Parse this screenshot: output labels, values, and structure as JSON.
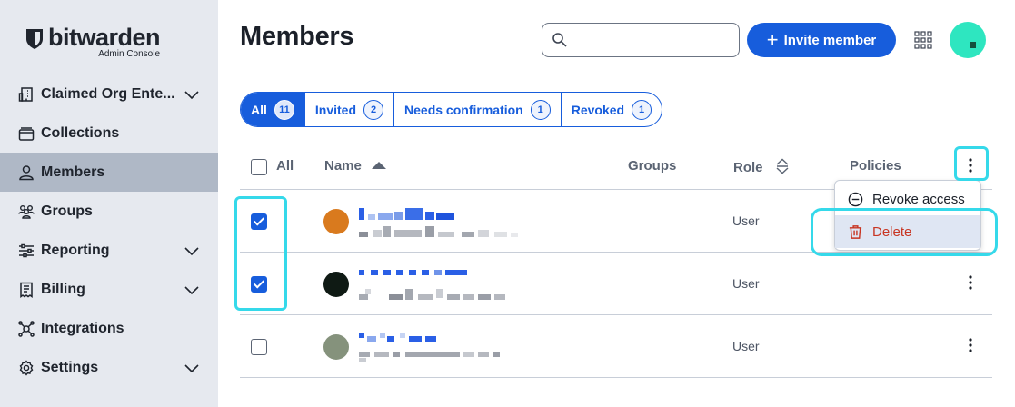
{
  "brand": {
    "name": "bitwarden",
    "subtitle": "Admin Console"
  },
  "sidebar": {
    "items": [
      {
        "label": "Claimed Org Ente...",
        "icon": "building-icon",
        "has_chevron": true
      },
      {
        "label": "Collections",
        "icon": "collections-icon",
        "has_chevron": false
      },
      {
        "label": "Members",
        "icon": "user-icon",
        "has_chevron": false,
        "active": true
      },
      {
        "label": "Groups",
        "icon": "users-icon",
        "has_chevron": false
      },
      {
        "label": "Reporting",
        "icon": "sliders-icon",
        "has_chevron": true
      },
      {
        "label": "Billing",
        "icon": "billing-icon",
        "has_chevron": true
      },
      {
        "label": "Integrations",
        "icon": "integrations-icon",
        "has_chevron": false
      },
      {
        "label": "Settings",
        "icon": "gear-icon",
        "has_chevron": true
      }
    ]
  },
  "header": {
    "title": "Members",
    "search_value": "",
    "invite_label": "Invite member"
  },
  "tabs": [
    {
      "label": "All",
      "count": "11",
      "active": true
    },
    {
      "label": "Invited",
      "count": "2"
    },
    {
      "label": "Needs confirmation",
      "count": "1"
    },
    {
      "label": "Revoked",
      "count": "1"
    }
  ],
  "table": {
    "select_all_label": "All",
    "columns": {
      "name": "Name",
      "groups": "Groups",
      "role": "Role",
      "policies": "Policies"
    },
    "rows": [
      {
        "role": "User",
        "checked": true,
        "avatar_color": "#d97a1e"
      },
      {
        "role": "User",
        "checked": true,
        "avatar_color": "#0f1a14"
      },
      {
        "role": "User",
        "checked": false,
        "avatar_color": "#85927c"
      }
    ]
  },
  "menu": {
    "revoke_label": "Revoke access",
    "delete_label": "Delete"
  },
  "colors": {
    "primary": "#175ddc",
    "highlight": "#35d9ea",
    "danger": "#c83522",
    "sidebar_bg": "#e6e9ef",
    "sidebar_active": "#afb8c6"
  }
}
